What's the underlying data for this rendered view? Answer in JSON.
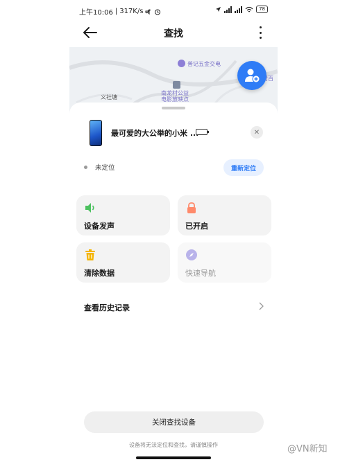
{
  "statusbar": {
    "time": "上午10:06",
    "speed": "317K/s",
    "battery": "78"
  },
  "header": {
    "title": "查找"
  },
  "map": {
    "labels": {
      "hardware": "普记五金交电",
      "village": "义社塘",
      "cinema": "南龙村公益电影放映点",
      "right_fragment": "村百"
    }
  },
  "device": {
    "name": "最可爱的大公举的小米 ..."
  },
  "location": {
    "status": "未定位",
    "relocate_label": "重新定位"
  },
  "actions": [
    {
      "label": "设备发声",
      "icon": "speaker-icon",
      "color": "#4cc15f",
      "enabled": true
    },
    {
      "label": "已开启",
      "icon": "lock-icon",
      "color": "#ff8a6b",
      "enabled": true
    },
    {
      "label": "清除数据",
      "icon": "trash-icon",
      "color": "#f4b400",
      "enabled": true
    },
    {
      "label": "快速导航",
      "icon": "compass-icon",
      "color": "#b9b3ea",
      "enabled": false
    }
  ],
  "history": {
    "label": "查看历史记录"
  },
  "footer": {
    "close_label": "关闭查找设备",
    "warning": "设备将无法定位和查找，请谨慎操作"
  },
  "watermark": "@VN新知",
  "colors": {
    "accent": "#2f7cf6",
    "accent_light": "#e7f0ff"
  }
}
